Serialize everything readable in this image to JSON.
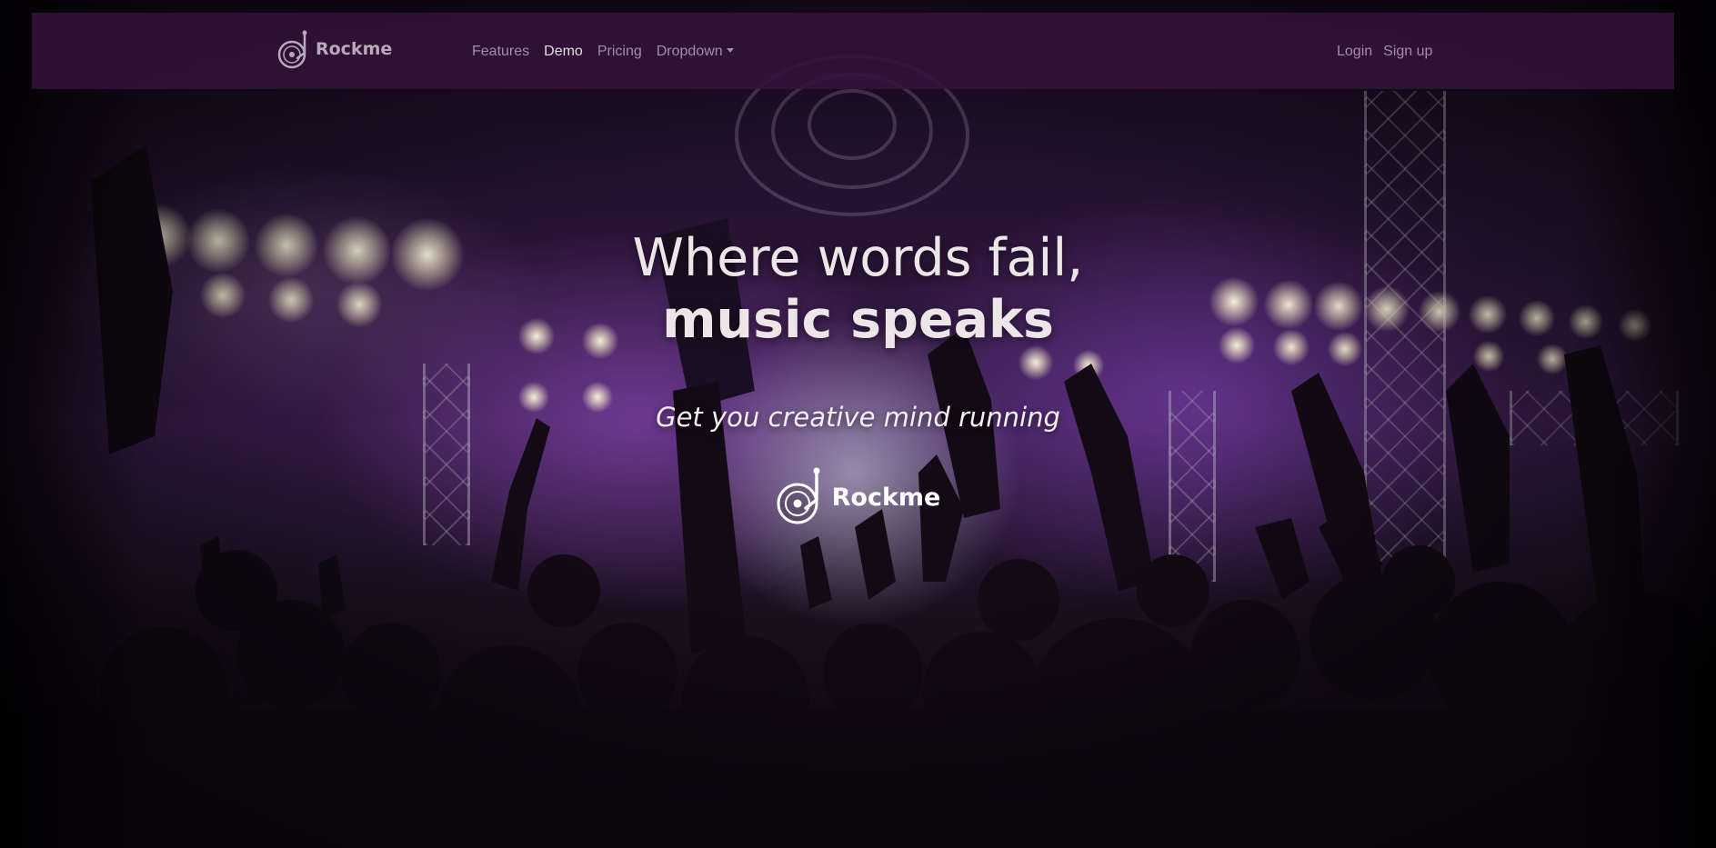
{
  "brand": {
    "name": "Rockme",
    "icon": "turntable-icon"
  },
  "nav": {
    "links": [
      "Features",
      "Demo",
      "Pricing",
      "Dropdown"
    ],
    "active": "Demo",
    "auth": [
      "Login",
      "Sign up"
    ]
  },
  "hero": {
    "title_line1": "Where words fail,",
    "title_line2": "music speaks",
    "subtitle": "Get you creative mind running",
    "logo_text": "Rockme"
  },
  "colors": {
    "navbar_bg": "#34123a",
    "accent_purple": "#7a3fa8"
  }
}
